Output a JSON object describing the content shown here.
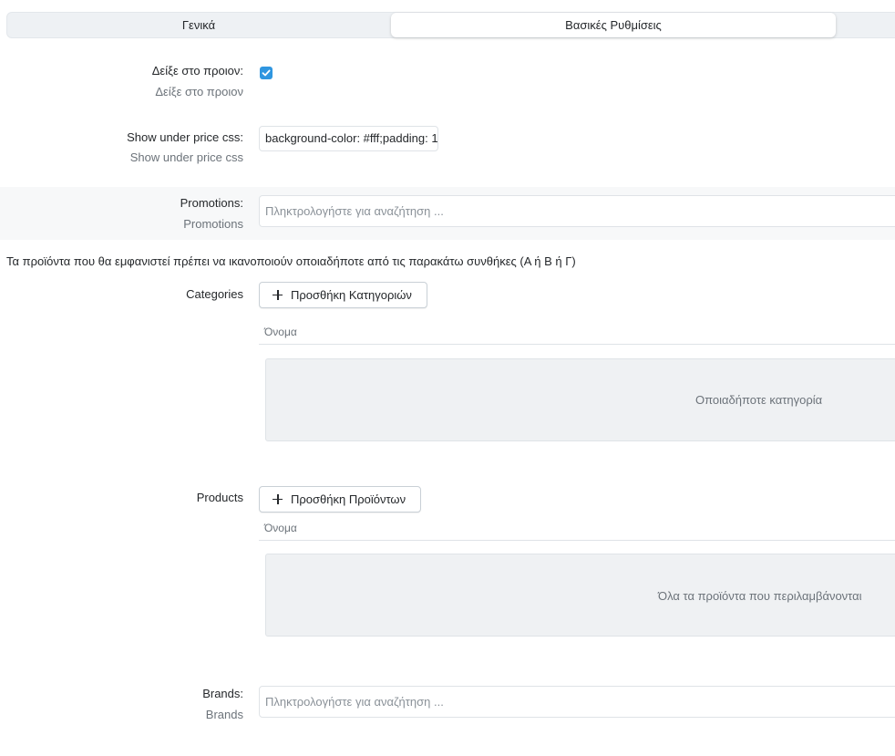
{
  "tabs": [
    {
      "label": "Γενικά",
      "active": false
    },
    {
      "label": "Βασικές Ρυθμίσεις",
      "active": true
    }
  ],
  "show_on_product": {
    "label": "Δείξε στο προιον:",
    "help": "Δείξε στο προιον",
    "checked": true
  },
  "under_price_css": {
    "label": "Show under price css:",
    "help": "Show under price css",
    "value": "background-color: #fff;padding: 1"
  },
  "promotions": {
    "label": "Promotions:",
    "help": "Promotions",
    "placeholder": "Πληκτρολογήστε για αναζήτηση ..."
  },
  "conditions_note": "Τα προϊόντα που θα εμφανιστεί πρέπει να ικανοποιούν οποιαδήποτε από τις παρακάτω συνθήκες (Α ή Β ή Γ)",
  "categories": {
    "label": "Categories",
    "add_button": "Προσθήκη Κατηγοριών",
    "column_name": "Όνομα",
    "empty_text": "Οποιαδήποτε κατηγορία"
  },
  "products": {
    "label": "Products",
    "add_button": "Προσθήκη Προϊόντων",
    "column_name": "Όνομα",
    "empty_text": "Όλα τα προϊόντα που περιλαμβάνονται"
  },
  "brands": {
    "label": "Brands:",
    "help": "Brands",
    "placeholder": "Πληκτρολογήστε για αναζήτηση ..."
  },
  "colors": {
    "accent": "#2f96e0",
    "panel": "#eff1f3",
    "muted_text": "#6c737a"
  },
  "icons": {
    "checkbox": "check-icon",
    "add": "plus-icon"
  }
}
